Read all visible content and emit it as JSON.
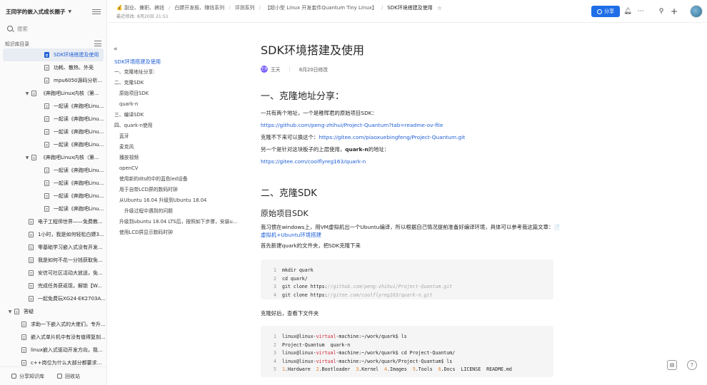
{
  "sidebar": {
    "kb_name": "王同学的嵌入式成长圈子",
    "search_placeholder": "搜索",
    "dir_label": "知识库目录",
    "items": [
      {
        "label": "SDK环境搭建及使用",
        "active": true
      },
      {
        "label": "功耗、散热、外壳"
      },
      {
        "label": "mpu6050源码分析..."
      },
      {
        "label": "《奔跑吧Linux内核（第..."
      },
      {
        "label": "一起读《奔跑吧Linu..."
      },
      {
        "label": "一起读《奔跑吧Linu..."
      },
      {
        "label": "一起读《奔跑吧Linu..."
      },
      {
        "label": "一起读《奔跑吧Linu..."
      },
      {
        "label": "《奔跑吧Linux内核（第..."
      },
      {
        "label": "一起读《奔跑吧Linu..."
      },
      {
        "label": "一起读《奔跑吧Linu..."
      },
      {
        "label": "一起读《奔跑吧Linu..."
      },
      {
        "label": "一起读《奔跑吧Linu..."
      },
      {
        "label": "电子工程师世界——免费教..."
      },
      {
        "label": "1小时，我是如何轻松白嫖3..."
      },
      {
        "label": "零基础学习嵌入式没有开发..."
      },
      {
        "label": "我是如何不花一分钱获取免..."
      },
      {
        "label": "安信可社区活动大放送，免..."
      },
      {
        "label": "完成任务获返现，解锁【W..."
      },
      {
        "label": "一起免费玩XG24-EK2703A..."
      },
      {
        "label": "答疑"
      },
      {
        "label": "求助一下嵌入式的大佬们，专升..."
      },
      {
        "label": "嵌入式单片机中有没有值得复刻..."
      },
      {
        "label": "linux嵌入式驱动开发方向，我..."
      },
      {
        "label": "c++岗位为什么大部分都要求熟..."
      }
    ],
    "share_kb": "分享知识库",
    "recycle": "回收站"
  },
  "topbar": {
    "crumbs": [
      "💰 副业、兼职、搞钱",
      "白嫖开发板、赚钱系列",
      "评测系列",
      "【超小型 Linux 开发套件Quantum Tiny Linux】",
      "SDK环境搭建及使用"
    ],
    "modified": "最近修改: 8月20日 21:51",
    "share": "分享"
  },
  "toc": {
    "items": [
      {
        "label": "SDK环境搭建及使用",
        "level": 1,
        "active": true
      },
      {
        "label": "一、克隆地址分享:",
        "level": 1
      },
      {
        "label": "二、克隆SDK",
        "level": 1
      },
      {
        "label": "原始项目SDK",
        "level": 2
      },
      {
        "label": "quark-n",
        "level": 2
      },
      {
        "label": "三、编译SDK",
        "level": 1
      },
      {
        "label": "四、quark-n使用",
        "level": 1
      },
      {
        "label": "蓝牙",
        "level": 2
      },
      {
        "label": "麦克风",
        "level": 2
      },
      {
        "label": "播放视频",
        "level": 2
      },
      {
        "label": "openCV",
        "level": 2
      },
      {
        "label": "使用新的dts的中的蓝色led设备",
        "level": 2
      },
      {
        "label": "用于自带LCD屏的数码时钟",
        "level": 2
      },
      {
        "label": "从Ubuntu 16.04 升级到Ubuntu 18.04",
        "level": 2
      },
      {
        "label": "升级过程中遇到的问题",
        "level": 3
      },
      {
        "label": "升级到ubuntu 18.04 LTS后，按照如下步骤，安装u...",
        "level": 2
      },
      {
        "label": "使用LCD屏显示数码时钟",
        "level": 2
      }
    ]
  },
  "doc": {
    "title": "SDK环境搭建及使用",
    "author": "王天",
    "author_initial": "王天",
    "date": "8月20日修改",
    "s1_title": "一、克隆地址分享：",
    "s1_p1": "一共有两个地址，一个是稚晖君的原始项目SDK：",
    "s1_link1": "https://github.com/peng-zhihui/Project-Quantum?tab=readme-ov-file",
    "s1_p2": "克隆不下来可以换这个：",
    "s1_link2": "https://gitee.com/piaoxuebingfeng/Project-Quantum.git",
    "s1_p3a": "另一个是针对这块板子的上层使用，",
    "s1_p3b": "quark-n",
    "s1_p3c": "的地址：",
    "s1_link3": "https://gitee.com/coolflyreg163/quark-n",
    "s2_title": "二、克隆SDK",
    "s2_sub": "原始项目SDK",
    "s2_p1": "我习惯在windows上，用VM虚拟机出一个Ubuntu编译，所以根据自己情况提前准备好编译环境，具体可以参考我这篇文章：",
    "s2_link": "📄虚拟机+Ubuntu环境搭建",
    "s2_p2": "首先新建quark的文件夹，把SDK克隆下来",
    "code1": [
      {
        "no": "1",
        "text": "mkdir quark"
      },
      {
        "no": "2",
        "text": "cd quark/"
      },
      {
        "no": "3",
        "text": "git clone https:",
        "comment": "//github.com/peng-zhihui/Project-Quantum.git"
      },
      {
        "no": "4",
        "text": "git clone https:",
        "comment": "//gitee.com/coolflyreg163/quark-n.git"
      }
    ],
    "s2_p3": "克隆好后，查看下文件夹",
    "code2": [
      {
        "no": "1",
        "a": "linux@linux-",
        "kw": "virtual",
        "b": "-machine:~/work/quark$ ls"
      },
      {
        "no": "2",
        "a": "Project-Quantum  quark-n",
        "kw": "",
        "b": ""
      },
      {
        "no": "3",
        "a": "linux@linux-",
        "kw": "virtual",
        "b": "-machine:~/work/quark$ cd Project-Quantum/"
      },
      {
        "no": "4",
        "a": "linux@linux-",
        "kw": "virtual",
        "b": "-machine:~/work/quark/Project-Quantum$ ls"
      }
    ],
    "code2_line5": [
      "1",
      "Hardware",
      "2",
      "Bootloader",
      "3",
      "Kernel",
      "4",
      "Images",
      "5",
      "Tools",
      "6",
      "Docs",
      "LICENSE  README.md"
    ]
  }
}
